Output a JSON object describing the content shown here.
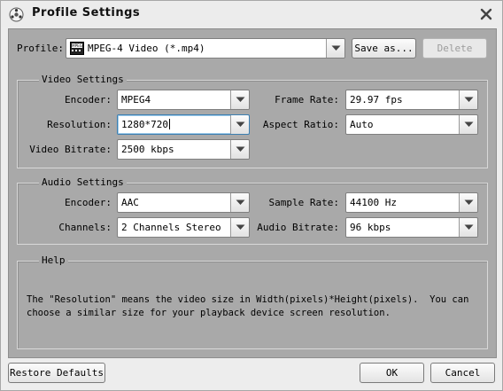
{
  "window": {
    "title": "Profile Settings"
  },
  "profile": {
    "label": "Profile:",
    "value": "MPEG-4 Video (*.mp4)",
    "icon_text": "MPEG",
    "save_as_label": "Save as...",
    "delete_label": "Delete"
  },
  "video": {
    "group_title": "Video Settings",
    "encoder_label": "Encoder:",
    "encoder_value": "MPEG4",
    "resolution_label": "Resolution:",
    "resolution_value": "1280*720",
    "bitrate_label": "Video Bitrate:",
    "bitrate_value": "2500 kbps",
    "framerate_label": "Frame Rate:",
    "framerate_value": "29.97 fps",
    "aspect_label": "Aspect Ratio:",
    "aspect_value": "Auto"
  },
  "audio": {
    "group_title": "Audio Settings",
    "encoder_label": "Encoder:",
    "encoder_value": "AAC",
    "channels_label": "Channels:",
    "channels_value": "2 Channels Stereo",
    "samplerate_label": "Sample Rate:",
    "samplerate_value": "44100 Hz",
    "bitrate_label": "Audio Bitrate:",
    "bitrate_value": "96 kbps"
  },
  "help": {
    "group_title": "Help",
    "line1": "The \"Resolution\" means the video size in Width(pixels)*Height(pixels).  You can",
    "line2": "choose a similar size for your playback device screen resolution."
  },
  "footer": {
    "restore_label": "Restore Defaults",
    "ok_label": "OK",
    "cancel_label": "Cancel"
  },
  "colors": {
    "panel": "#a9a9a9",
    "window": "#ededed",
    "focus": "#3c7fb1"
  }
}
